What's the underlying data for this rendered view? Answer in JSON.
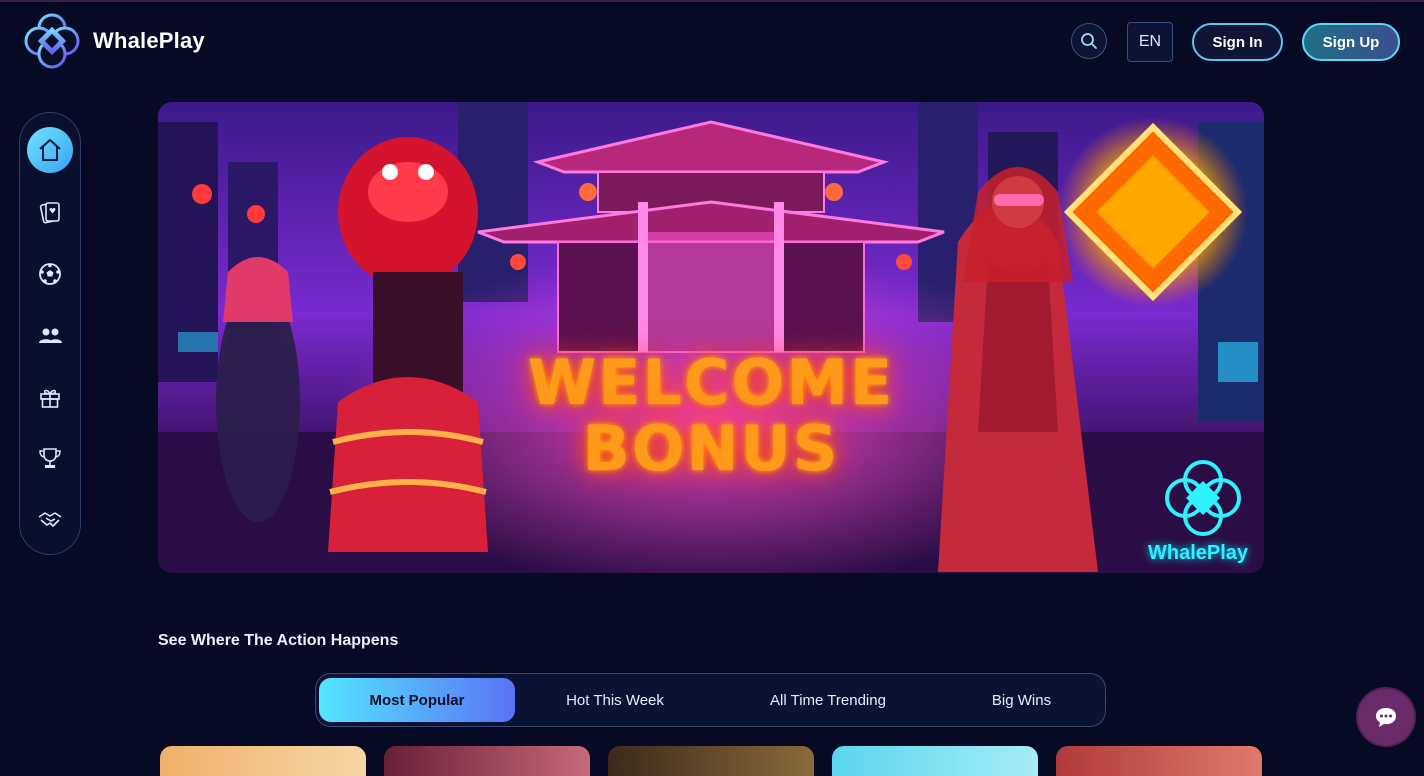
{
  "header": {
    "brand": "WhalePlay",
    "language": "EN",
    "signin_label": "Sign In",
    "signup_label": "Sign Up"
  },
  "sidebar": {
    "items": [
      {
        "icon": "home-icon",
        "active": true
      },
      {
        "icon": "cards-icon",
        "active": false
      },
      {
        "icon": "soccer-ball-icon",
        "active": false
      },
      {
        "icon": "users-icon",
        "active": false
      },
      {
        "icon": "gift-icon",
        "active": false
      },
      {
        "icon": "trophy-icon",
        "active": false
      },
      {
        "icon": "handshake-icon",
        "active": false
      }
    ]
  },
  "banner": {
    "headline_line1": "WELCOME",
    "headline_line2": "BONUS",
    "logo_text": "WhalePlay"
  },
  "section": {
    "title": "See Where The Action Happens",
    "tabs": [
      {
        "label": "Most Popular",
        "active": true
      },
      {
        "label": "Hot This Week",
        "active": false
      },
      {
        "label": "All Time Trending",
        "active": false
      },
      {
        "label": "Big Wins",
        "active": false
      }
    ]
  },
  "colors": {
    "background": "#070a24",
    "accent_cyan": "#53e6ff",
    "accent_blue": "#5a73f5",
    "chat_button": "#6a2b6a"
  }
}
